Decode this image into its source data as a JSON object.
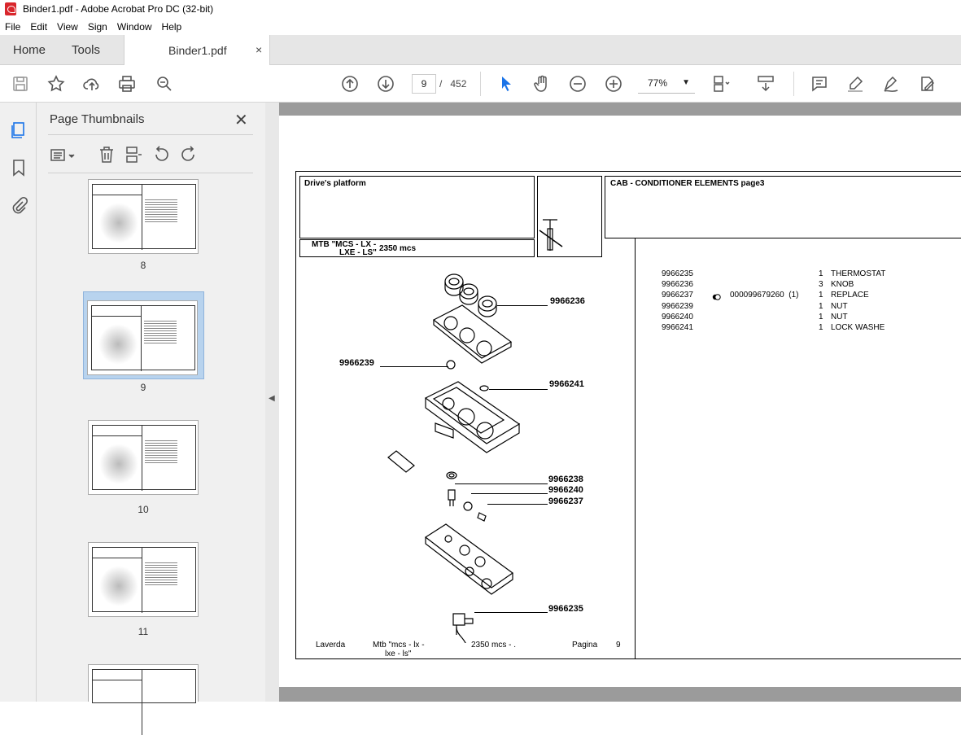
{
  "window": {
    "title": "Binder1.pdf - Adobe Acrobat Pro DC (32-bit)"
  },
  "menu": [
    "File",
    "Edit",
    "View",
    "Sign",
    "Window",
    "Help"
  ],
  "tabs": {
    "home": "Home",
    "tools": "Tools",
    "file": "Binder1.pdf",
    "close": "×"
  },
  "toolbar": {
    "page_current": "9",
    "page_sep": "/",
    "page_total": "452",
    "zoom": "77%"
  },
  "panel": {
    "title": "Page Thumbnails",
    "close": "✕",
    "thumbs": [
      {
        "label": "8"
      },
      {
        "label": "9"
      },
      {
        "label": "10"
      },
      {
        "label": "11"
      }
    ]
  },
  "doc": {
    "header_left": "Drive's platform",
    "header_right": "CAB - CONDITIONER ELEMENTS  page3",
    "model_line1": "MTB \"MCS - LX -",
    "model_line2": "LXE - LS\"",
    "model_code": "2350  mcs",
    "parts": {
      "codes": [
        "9966235",
        "9966236",
        "9966237",
        "9966239",
        "9966240",
        "9966241"
      ],
      "refs": [
        "",
        "",
        "000099679260  (1)",
        "",
        "",
        ""
      ],
      "qty": [
        "1",
        "3",
        "1",
        "1",
        "1",
        "1"
      ],
      "desc": [
        "THERMOSTAT",
        "KNOB",
        "REPLACE",
        "NUT",
        "NUT",
        "LOCK WASHE"
      ]
    },
    "callouts": {
      "c236": "9966236",
      "c239": "9966239",
      "c241": "9966241",
      "c238": "9966238",
      "c240": "9966240",
      "c237": "9966237",
      "c235": "9966235"
    },
    "footer": {
      "brand": "Laverda",
      "model1": "Mtb \"mcs - lx -",
      "model2": "lxe - ls\"",
      "code": "2350  mcs - .",
      "page_label": "Pagina",
      "page_no": "9"
    }
  }
}
